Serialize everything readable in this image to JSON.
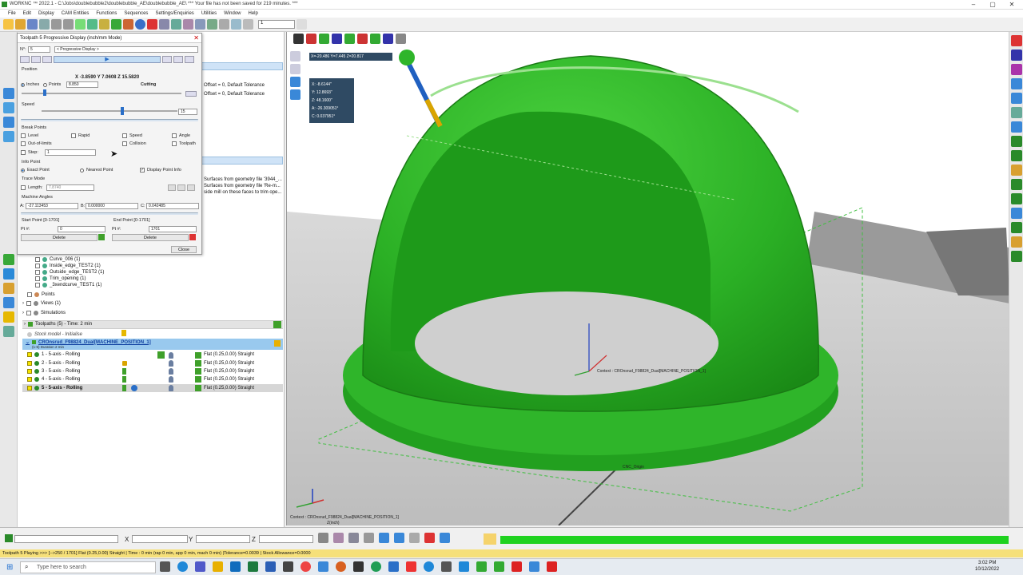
{
  "app": {
    "title": "WORKNC ™ 2022.1 - C:\\Jobs\\doublebubble2\\doublebubble_AE\\doublebubble_AE\\ *** Your file has not been saved for 219 minutes. ***",
    "menus": [
      "File",
      "Edit",
      "Display",
      "CAM Entities",
      "Functions",
      "Sequences",
      "Settings/Enquiries",
      "Utilities",
      "Window",
      "Help"
    ],
    "toolbar_combo": "1"
  },
  "dialog": {
    "title": "Toolpath 5 Progressive Display (inch/mm Mode)",
    "n_label": "N°:",
    "n_value": "5",
    "mode_select": "< Progressive Display >",
    "position_label": "Position",
    "coords": "X -3.8590 Y 7.0608 Z 15.5820",
    "inches_label": "Inches",
    "points_label": "Points",
    "points_value": "8.850",
    "cutting_label": "Cutting",
    "speed_label": "Speed",
    "speed_value": "15",
    "breakpoints_label": "Break Points",
    "bp_level": "Level",
    "bp_rapid": "Rapid",
    "bp_speed": "Speed",
    "bp_angle": "Angle",
    "bp_outoflimits": "Out-of-limits",
    "bp_collision": "Collision",
    "bp_toolpath": "Toolpath",
    "bp_step": "Step:",
    "bp_step_value": "1",
    "infopoint_label": "Info Point",
    "exact_point": "Exact Point",
    "nearest_point": "Nearest Point",
    "display_point_info": "Display Point Info",
    "trace_mode": "Trace Mode",
    "length_label": "Length:",
    "length_value": "7.8740",
    "machine_angles": "Machine Angles",
    "a_label": "A:",
    "a_value": "-27.113453",
    "b_label": "B:",
    "b_value": "0.000000",
    "c_label": "C:",
    "c_value": "0.042485",
    "start_point_label": "Start Point [0-1701]",
    "end_point_label": "End Point [0-1701]",
    "pt_label": "Pt #:",
    "start_pt": "0",
    "end_pt": "1701",
    "delete_label": "Delete",
    "close_label": "Close"
  },
  "tree_right_texts": {
    "offset1": "Offset = 0, Default Tolerance",
    "offset2": "Offset = 0, Default Tolerance",
    "surf1": "Surfaces from geometry file '3944_...",
    "surf2": "Surfaces from geometry file 'Re-m...",
    "surf3": "side mill on these faces to trim ope..."
  },
  "tree": {
    "curves": [
      "Curve_006 (1)",
      "Inside_edge_TEST2 (1)",
      "Outside_edge_TEST2 (1)",
      "Trim_opening (1)",
      "_3xendcurve_TEST1 (1)"
    ],
    "points": "Points",
    "views": "Views (1)",
    "simulations": "Simulations",
    "toolpaths_header": "Toolpaths (5) - Time: 2 min",
    "stock_model": "Stock model - Initialise",
    "machine": "CROnsrud_F98824_Dual[MACHINE_POSITION_1]",
    "duration": "(1-5) Duration 2 min",
    "toolpaths": [
      {
        "label": "1 - 5-axis - Rolling",
        "tool": "Flat (0.25,0.00) Straight"
      },
      {
        "label": "2 - 5-axis - Rolling",
        "tool": "Flat (0.25,0.00) Straight"
      },
      {
        "label": "3 - 5-axis - Rolling",
        "tool": "Flat (0.25,0.00) Straight"
      },
      {
        "label": "4 - 5-axis - Rolling",
        "tool": "Flat (0.25,0.00) Straight"
      },
      {
        "label": "5 - 5-axis - Rolling",
        "tool": "Flat (0.25,0.00) Straight"
      }
    ]
  },
  "viewport": {
    "xyz_readout": "X=-20.486   Y=7.445   Z=20.817",
    "info_values": [
      "X: -8.6144\"",
      "Y: 12.8693\"",
      "Z: 48.1600\"",
      "A: -26.309051°",
      "C: 0.037951°"
    ],
    "context_label": "Context : CROnsrud_F98824_Dual[MACHINE_POSITION_1]",
    "cnc_origin": "CNC_Origin",
    "bottom_context": "Context : CROnsrud_F98824_Dual[MACHINE_POSITION_1]",
    "bottom_context2": "Z(inch)",
    "model_color": "#2fb52a",
    "accent_edge": "#1e8a1a"
  },
  "cmdbar": {
    "x_label": "X",
    "y_label": "Y",
    "z_label": "Z",
    "progress_color": "#1fd21f"
  },
  "status": "Toolpath 5   Playing >>> [-->250 / 1701]   Flat (0.25,0.00) Straight   | Time : 0 min (rap 0 min, app 0 min, mach 0 min) |Tolerance=0.0039 | Stock Allowance=0.0000",
  "taskbar": {
    "search_placeholder": "Type here to search",
    "time": "3:02 PM",
    "date": "10/12/2022"
  }
}
